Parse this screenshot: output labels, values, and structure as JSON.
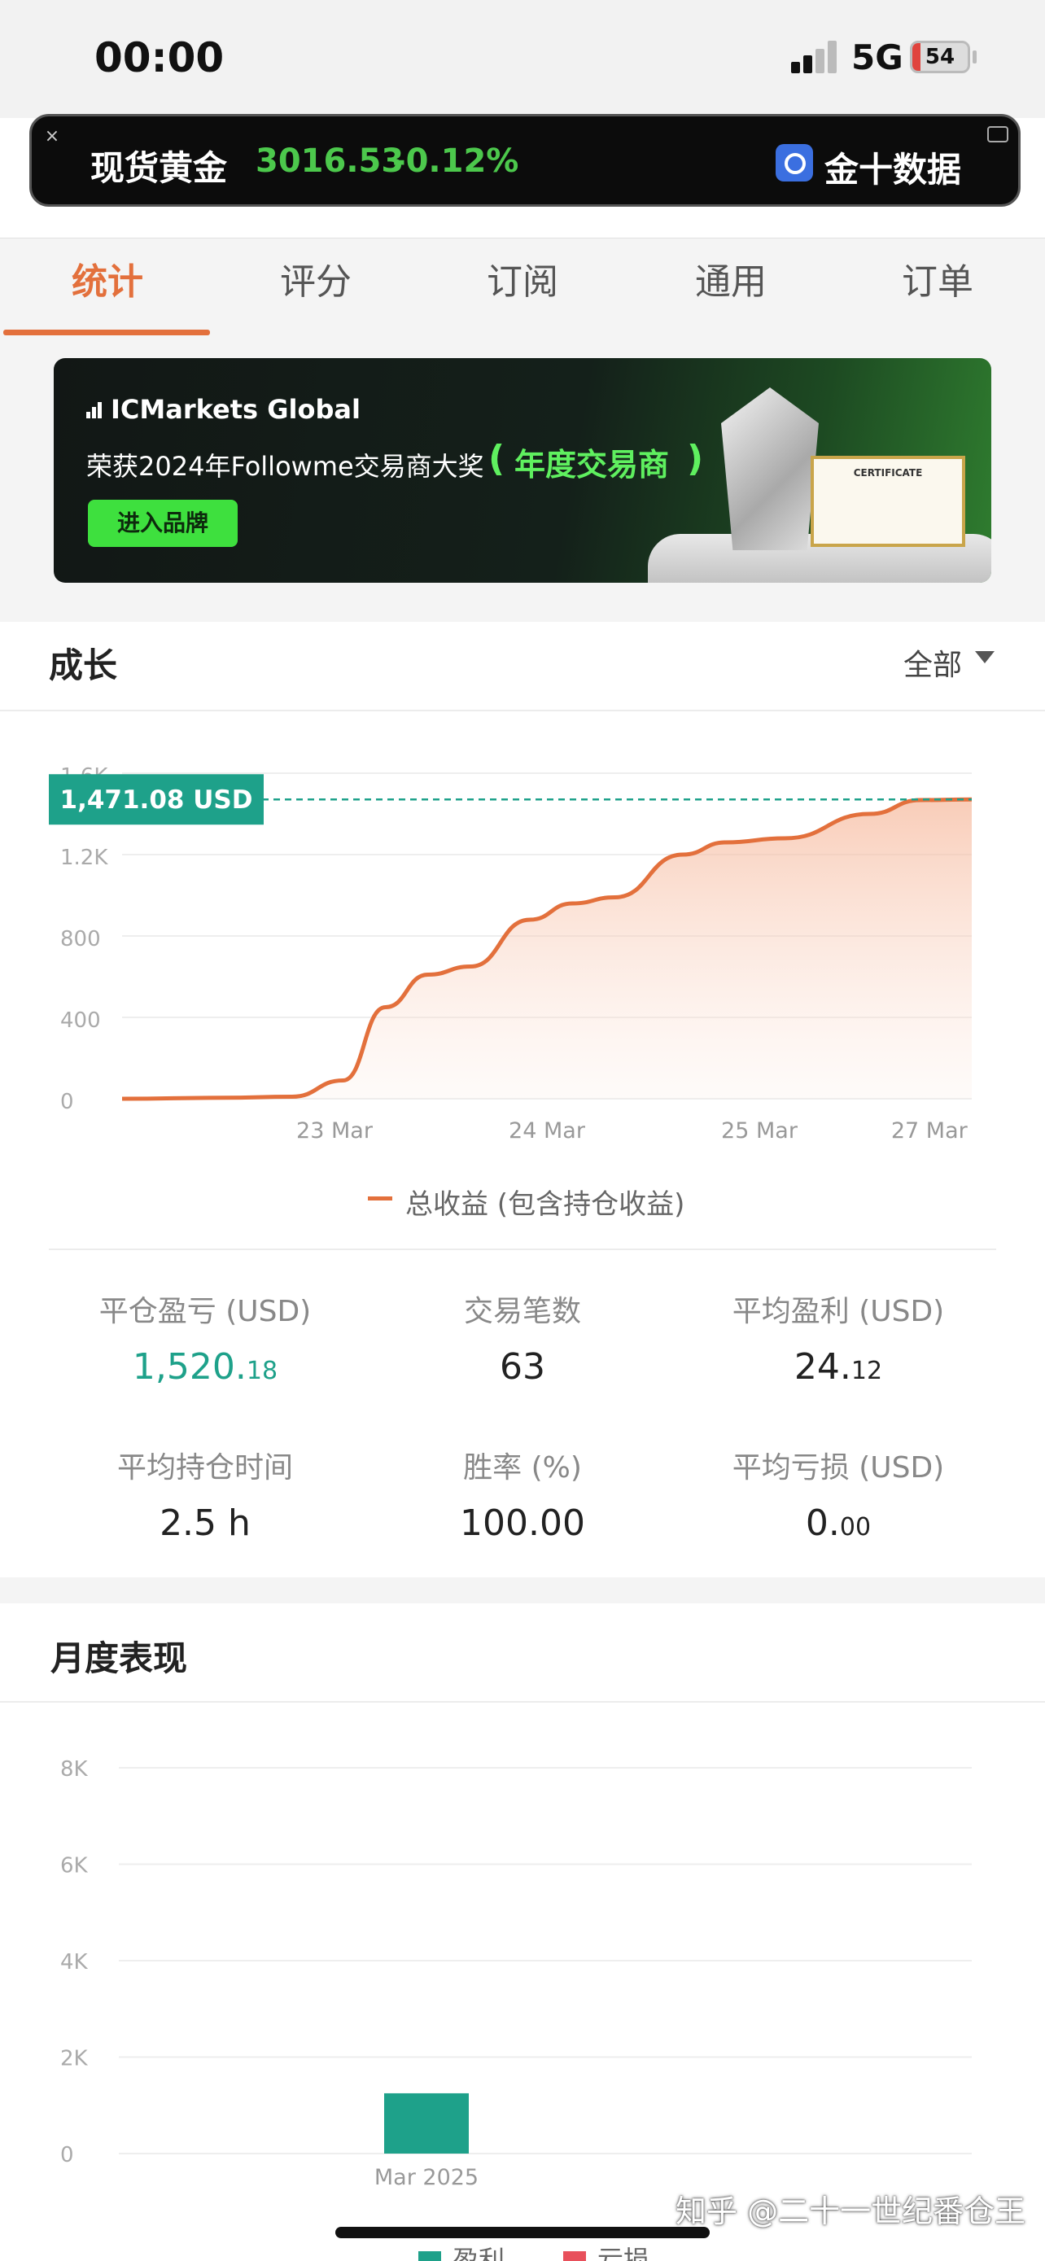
{
  "status_bar": {
    "time": "00:00",
    "network": "5G",
    "battery": "54"
  },
  "ticker": {
    "name": "现货黄金",
    "price": "3016.53",
    "change": "-0.12%",
    "brand": "金十数据"
  },
  "tabs": [
    {
      "label": "统计",
      "active": true
    },
    {
      "label": "评分",
      "active": false
    },
    {
      "label": "订阅",
      "active": false
    },
    {
      "label": "通用",
      "active": false
    },
    {
      "label": "订单",
      "active": false
    }
  ],
  "ad": {
    "logo": "ICMarkets Global",
    "tagline": "荣获2024年Followme交易商大奖",
    "award": "年度交易商",
    "cta": "进入品牌",
    "certificate_title": "CERTIFICATE"
  },
  "growth": {
    "title": "成长",
    "filter": "全部",
    "current_value": "1,471.08 USD",
    "legend": "总收益 (包含持仓收益)"
  },
  "stats": [
    {
      "label": "平仓盈亏 (USD)",
      "int": "1,520.",
      "dec": "18",
      "green": true
    },
    {
      "label": "交易笔数",
      "int": "63",
      "dec": "",
      "green": false
    },
    {
      "label": "平均盈利 (USD)",
      "int": "24.",
      "dec": "12",
      "green": false
    },
    {
      "label": "平均持仓时间",
      "int": "2.5 h",
      "dec": "",
      "green": false
    },
    {
      "label": "胜率 (%)",
      "int": "100.00",
      "dec": "",
      "green": false
    },
    {
      "label": "平均亏损 (USD)",
      "int": "0.",
      "dec": "00",
      "green": false
    }
  ],
  "monthly": {
    "title": "月度表现",
    "legend_profit": "盈利",
    "legend_loss": "亏损"
  },
  "watermark": "知乎 @二十一世纪番仓王",
  "colors": {
    "accent": "#e3703c",
    "green": "#1ea18a",
    "loss": "#e8505b"
  },
  "chart_data": [
    {
      "type": "area",
      "title": "",
      "xlabel": "",
      "ylabel": "",
      "x_ticks": [
        "23 Mar",
        "24 Mar",
        "25 Mar",
        "27 Mar"
      ],
      "y_ticks": [
        "0",
        "400",
        "800",
        "1.2K",
        "1.6K"
      ],
      "ylim": [
        0,
        1600
      ],
      "series": [
        {
          "name": "总收益 (包含持仓收益)",
          "points": [
            {
              "x": 0,
              "y": 0
            },
            {
              "x": 0.12,
              "y": 5
            },
            {
              "x": 0.2,
              "y": 10
            },
            {
              "x": 0.26,
              "y": 90
            },
            {
              "x": 0.31,
              "y": 450
            },
            {
              "x": 0.36,
              "y": 610
            },
            {
              "x": 0.41,
              "y": 650
            },
            {
              "x": 0.48,
              "y": 880
            },
            {
              "x": 0.53,
              "y": 960
            },
            {
              "x": 0.58,
              "y": 990
            },
            {
              "x": 0.66,
              "y": 1200
            },
            {
              "x": 0.71,
              "y": 1260
            },
            {
              "x": 0.78,
              "y": 1280
            },
            {
              "x": 0.88,
              "y": 1400
            },
            {
              "x": 0.94,
              "y": 1468
            },
            {
              "x": 1,
              "y": 1471.08
            }
          ]
        }
      ],
      "x_tick_positions": [
        0.25,
        0.5,
        0.75,
        0.95
      ],
      "grid": true,
      "legend": "bottom"
    },
    {
      "type": "bar",
      "title": "",
      "categories": [
        "Mar 2025"
      ],
      "y_ticks": [
        "0",
        "2K",
        "4K",
        "6K",
        "8K"
      ],
      "ylim": [
        0,
        8000
      ],
      "series": [
        {
          "name": "盈利",
          "values": [
            1250
          ]
        },
        {
          "name": "亏损",
          "values": [
            0
          ]
        }
      ],
      "grid": true,
      "legend": "bottom"
    }
  ]
}
